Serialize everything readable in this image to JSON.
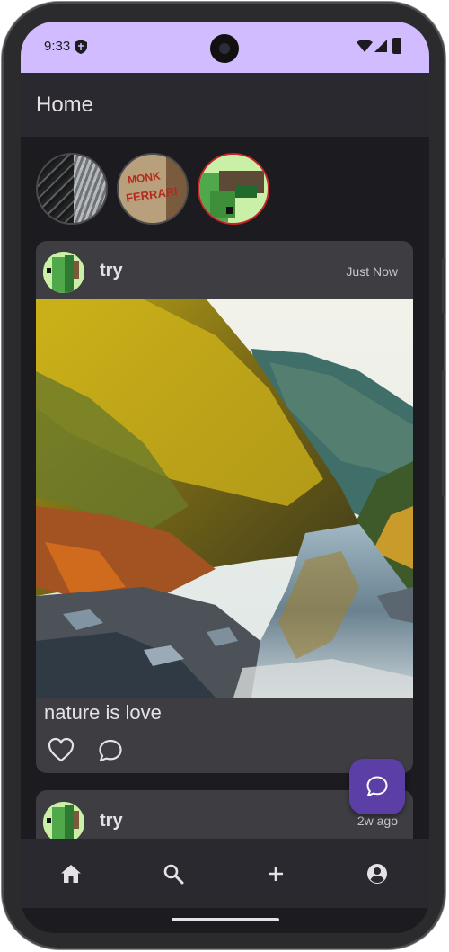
{
  "status_bar": {
    "time": "9:33",
    "background": "#d0bcff",
    "icons": [
      "shield-icon",
      "wifi-icon",
      "signal-icon",
      "battery-icon"
    ]
  },
  "app_bar": {
    "title": "Home"
  },
  "stories": [
    {
      "name": "story-laptop-keyboard"
    },
    {
      "name": "story-book-cover",
      "cover_text": [
        "MONK",
        "FERRARI"
      ]
    },
    {
      "name": "story-green-pixel-avatar",
      "ring_color": "#c3242b"
    }
  ],
  "posts": [
    {
      "username": "try",
      "timestamp": "Just Now",
      "caption": "nature is love",
      "image": "river-canyon-autumn-forest"
    },
    {
      "username": "try",
      "timestamp": "2w ago"
    }
  ],
  "fab": {
    "icon": "chat-bubble-icon",
    "color": "#5b3fa6"
  },
  "bottom_nav": {
    "items": [
      "home-icon",
      "search-icon",
      "add-icon",
      "account-icon"
    ],
    "active": "home-icon"
  },
  "theme": {
    "background": "#1c1b20",
    "surface": "#2a2930",
    "card": "#3e3e42",
    "accent": "#d0bcff"
  }
}
